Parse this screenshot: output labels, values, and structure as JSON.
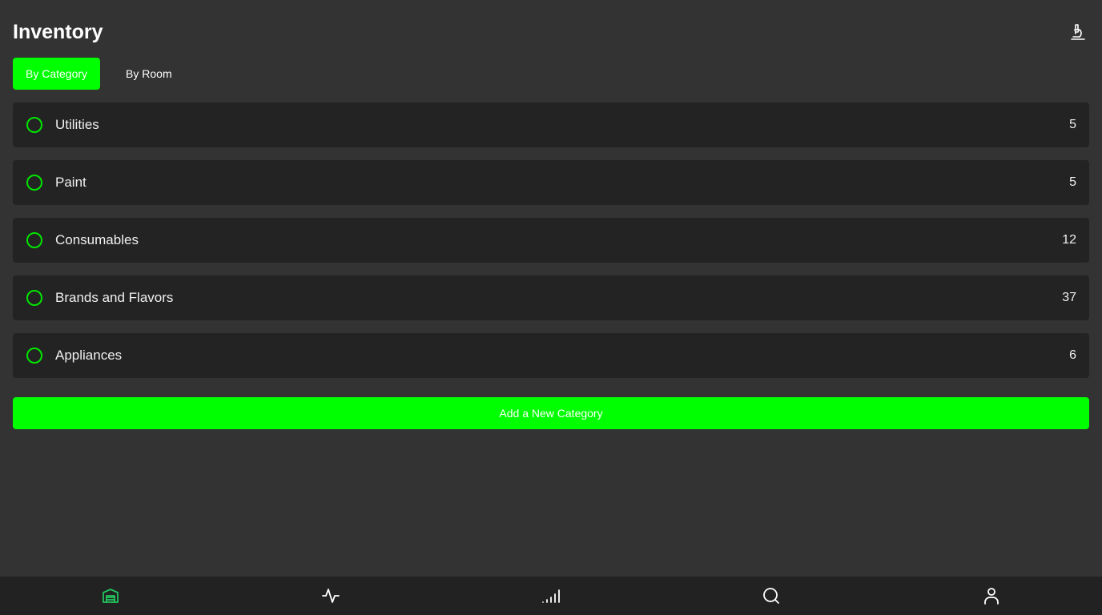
{
  "header": {
    "title": "Inventory",
    "action_icon": "microscope-icon"
  },
  "tabs": [
    {
      "label": "By Category",
      "active": true
    },
    {
      "label": "By Room",
      "active": false
    }
  ],
  "categories": [
    {
      "label": "Utilities",
      "count": "5"
    },
    {
      "label": "Paint",
      "count": "5"
    },
    {
      "label": "Consumables",
      "count": "12"
    },
    {
      "label": "Brands and Flavors",
      "count": "37"
    },
    {
      "label": "Appliances",
      "count": "6"
    }
  ],
  "add_button": {
    "label": "Add a New Category"
  },
  "bottom_nav": [
    {
      "icon": "warehouse-icon",
      "active": true
    },
    {
      "icon": "activity-icon",
      "active": false
    },
    {
      "icon": "signal-bars-icon",
      "active": false
    },
    {
      "icon": "search-icon",
      "active": false
    },
    {
      "icon": "user-icon",
      "active": false
    }
  ],
  "colors": {
    "accent": "#00ff00",
    "background": "#333333",
    "row_background": "#232323",
    "nav_background": "#222222"
  }
}
